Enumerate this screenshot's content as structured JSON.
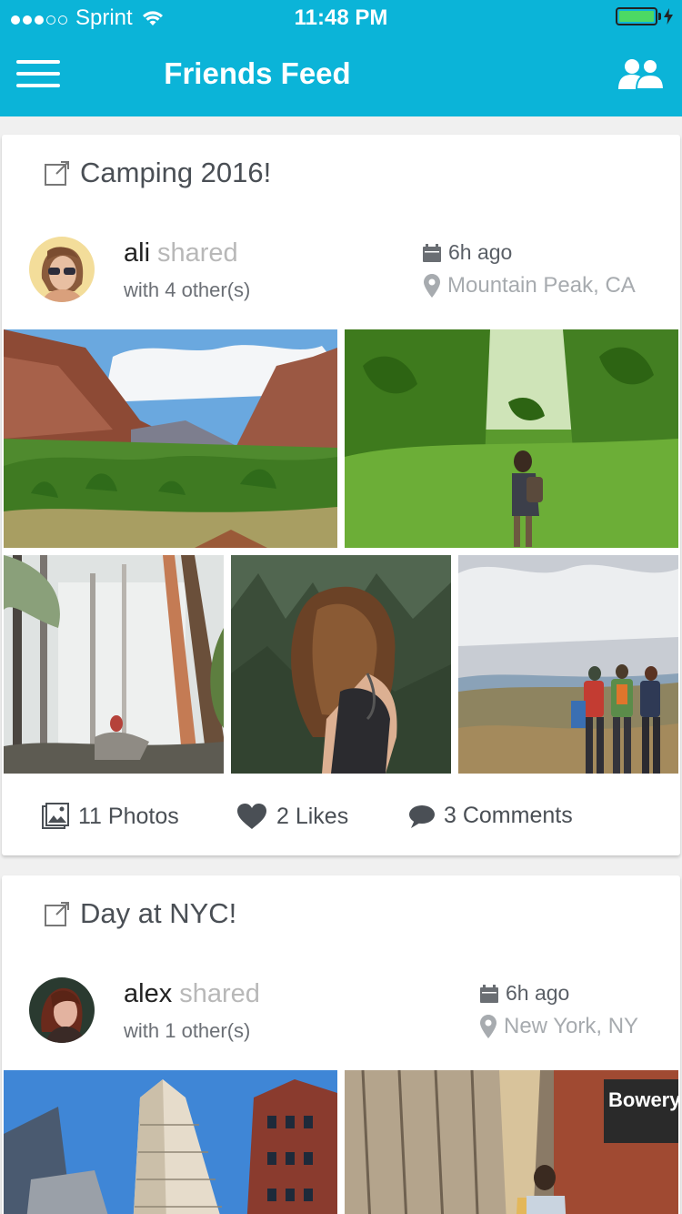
{
  "status_bar": {
    "carrier": "Sprint",
    "time": "11:48 PM",
    "signal_bars": 3,
    "signal_total": 5
  },
  "nav": {
    "title": "Friends Feed",
    "menu_icon": "hamburger-menu-icon",
    "friends_icon": "friends-group-icon"
  },
  "colors": {
    "header": "#0bb4d8",
    "battery": "#4cd964",
    "text": "#4a4f55",
    "muted": "#b8b8b8"
  },
  "posts": [
    {
      "title": "Camping 2016!",
      "user": "ali",
      "shared_label": "shared",
      "with_others": "with 4 other(s)",
      "time": "6h ago",
      "location": "Mountain Peak, CA",
      "photos": [
        "canyon",
        "forest-hiker",
        "misty-forest",
        "woman-hair",
        "group-overlook"
      ],
      "stats": {
        "photos": "11 Photos",
        "likes": "2 Likes",
        "comments": "3 Comments"
      }
    },
    {
      "title": "Day at NYC!",
      "user": "alex",
      "shared_label": "shared",
      "with_others": "with 1 other(s)",
      "time": "6h ago",
      "location": "New York, NY",
      "photos": [
        "flatiron-building",
        "bowery-subway"
      ],
      "sign_text": "Bowery"
    }
  ]
}
